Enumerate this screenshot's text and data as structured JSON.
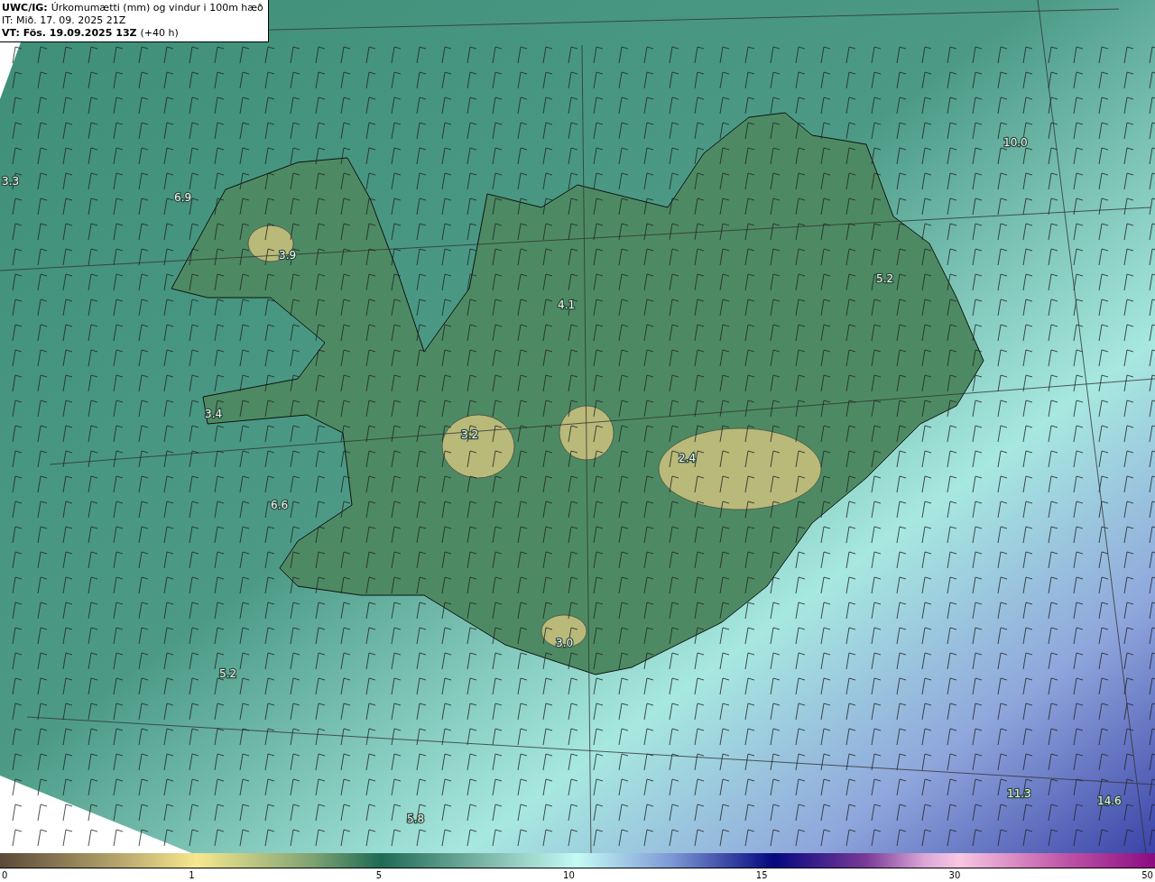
{
  "header": {
    "model": "UWC/IG:",
    "title": "Úrkomumætti (mm) og vindur i 100m hæð",
    "init_time": "IT: Mið. 17. 09. 2025 21Z",
    "valid_time": "VT: Fös. 19.09.2025 13Z",
    "lead": "(+40 h)"
  },
  "map_values": [
    "3.3",
    "6.9",
    "3.9",
    "4.1",
    "5.2",
    "10.0",
    "3.4",
    "3.2",
    "2.4",
    "6.6",
    "3.0",
    "5.2",
    "5.8",
    "11.3",
    "14.6"
  ],
  "colorbar": {
    "ticks": [
      "0",
      "1",
      "5",
      "10",
      "15",
      "30",
      "50"
    ]
  }
}
